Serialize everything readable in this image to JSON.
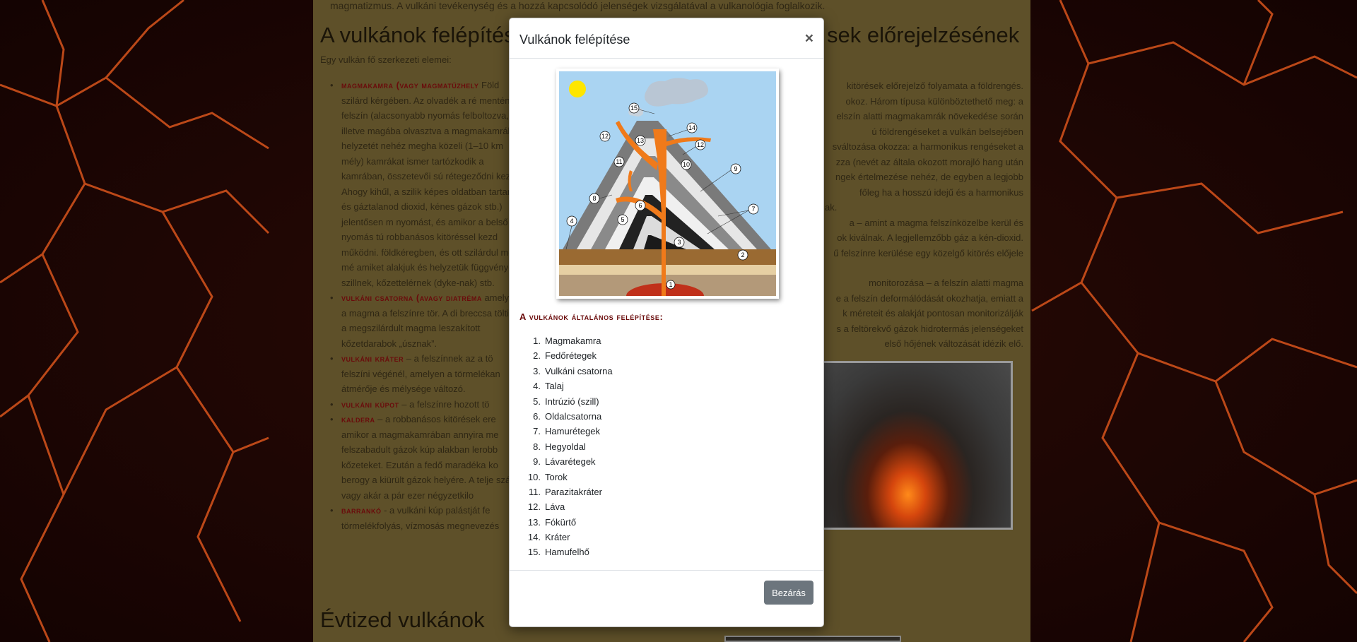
{
  "page": {
    "intro_text": "magmatizmus. A vulkáni tevékenység és a hozzá kapcsolódó jelenségek vizsgálatával a vulkanológia foglalkozik.",
    "heading_left": "A vulkánok felépítése",
    "heading_right": "sek előrejelzésének",
    "heading_bottom": "Évtized vulkánok",
    "subline": "Egy vulkán fő szerkezeti elemei:",
    "bullets": [
      {
        "term": "magmakamra (vagy magmatűzhely",
        "text": " Föld szilárd kérgében. Az olvadék a ré mentén a felszín (alacsonyabb nyomás felboltozva, illetve magába olvasztva a magmakamrák helyzetét nehéz megha közeli (1–10 km mély) kamrákat ismer tartózkodik a kamrában, összetevői sú rétegeződni kezd. Ahogy kihűl, a szilik képes oldatban tartani, és gáztalanod dioxid, kénes gázok stb.) jelentősen m nyomást, és amikor a belső nyomás tú robbanásos kitöréssel kezd működni. földkéregben, és ott szilárdul meg, mé amiket alakjuk és helyzetük függvénye szillnek, kőzettelérnek (dyke-nak) stb."
      },
      {
        "term": "vulkáni csatorna (avagy diatréma",
        "text": " amelyen a magma a felszínre tör. A di breccsa tölti ki: a megszilárdult magma leszakított kőzetdarabok „úsznak”."
      },
      {
        "term": "vulkáni kráter",
        "text": " – a felszínnek az a tö felszíni végénél, amelyen a törmelékan átmérője és mélysége változó."
      },
      {
        "term": "vulkáni kúpot",
        "text": " – a felszínre hozott tö"
      },
      {
        "term": "kaldera",
        "text": " – a robbanásos kitörések ere amikor a magmakamrában annyira me felszabadult gázok kúp alakban lerobb kőzeteket. Ezután a fedő maradéka ko berogy a kiürült gázok helyére. A telje száz, vagy akár a pár ezer négyzetkilo"
      },
      {
        "term": "barrankó",
        "text": " - a vulkáni kúp palástját fe törmelékfolyás, vízmosás megnevezés"
      }
    ],
    "right_text": [
      "kitörések előrejelző folyamata a földrengés.",
      "okoz. Három típusa különböztethető meg: a",
      "elszín alatti magmakamrák növekedése során",
      "ú földrengéseket a vulkán belsejében",
      "sváltozása okozza: a harmonikus rengéseket a",
      "zza (nevét az általa okozott morajló hang után",
      "ngek értelmezése nehéz, de egyben a legjobb",
      "főleg ha a hosszú idejű és a harmonikus",
      "ak."
    ],
    "right_text2": [
      "a – amint a magma felszínközelbe kerül és",
      "ok kiválnak. A legjellemzőbb gáz a kén-dioxid.",
      "ű felszínre kerülése egy közelgő kitörés előjele"
    ],
    "right_text3": [
      "monitorozása – a felszín alatti magma",
      "e a felszín deformálódását okozhatja, emiatt a",
      "k méreteit és alakját pontosan monitorizálják",
      "s a feltörekvő gázok hidrotermás jelenségeket",
      "első hőjének változását idézik elő."
    ]
  },
  "modal": {
    "title": "Vulkánok felépítése",
    "close_symbol": "×",
    "section_title": "A vulkánok általános felépítése:",
    "parts": [
      {
        "num": "1.",
        "label": "Magmakamra"
      },
      {
        "num": "2.",
        "label": "Fedőrétegek"
      },
      {
        "num": "3.",
        "label": "Vulkáni csatorna"
      },
      {
        "num": "4.",
        "label": "Talaj"
      },
      {
        "num": "5.",
        "label": "Intrúzió (szill)"
      },
      {
        "num": "6.",
        "label": "Oldalcsatorna"
      },
      {
        "num": "7.",
        "label": "Hamurétegek"
      },
      {
        "num": "8.",
        "label": "Hegyoldal"
      },
      {
        "num": "9.",
        "label": "Lávarétegek"
      },
      {
        "num": "10.",
        "label": "Torok"
      },
      {
        "num": "11.",
        "label": "Parazitakráter"
      },
      {
        "num": "12.",
        "label": "Láva"
      },
      {
        "num": "13.",
        "label": "Fókürtő"
      },
      {
        "num": "14.",
        "label": "Kráter"
      },
      {
        "num": "15.",
        "label": "Hamufelhő"
      }
    ],
    "close_button": "Bezárás",
    "diagram_markers": [
      "1",
      "2",
      "3",
      "4",
      "5",
      "6",
      "7",
      "8",
      "9",
      "10",
      "11",
      "12",
      "12",
      "13",
      "14",
      "15"
    ]
  },
  "colors": {
    "accent_term": "#6a0b0b",
    "button_gray": "#6c757d",
    "lava": "#f07a1a"
  }
}
